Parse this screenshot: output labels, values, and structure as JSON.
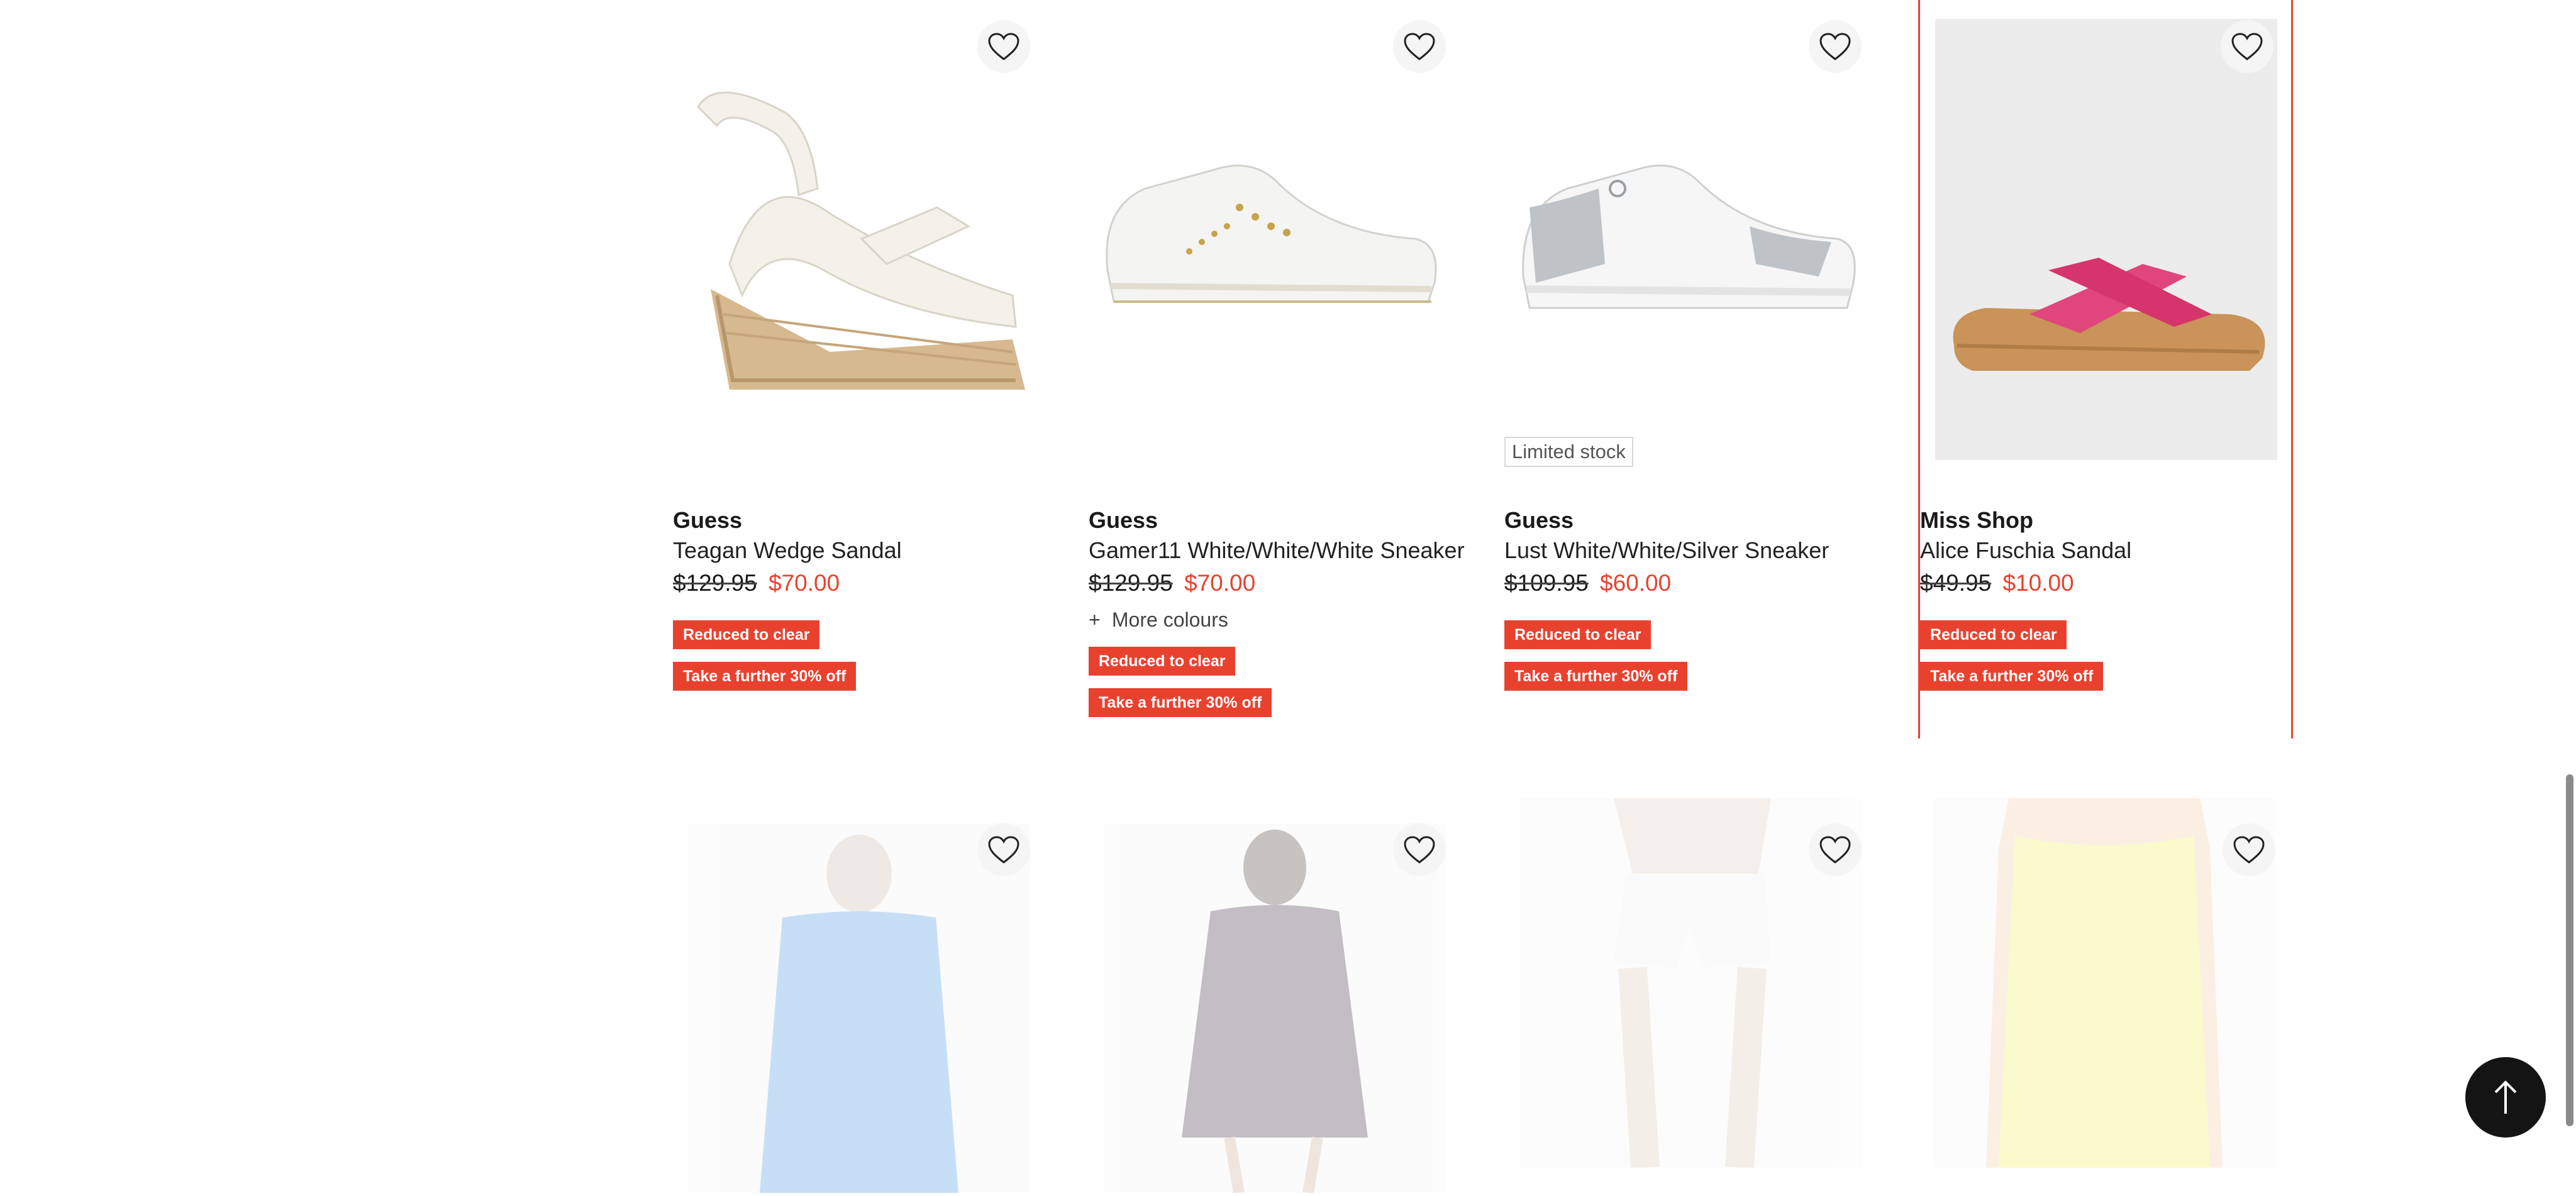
{
  "products": [
    {
      "brand": "Guess",
      "name": "Teagan Wedge Sandal",
      "was_price": "$129.95",
      "now_price": "$70.00",
      "tags": [
        "Reduced to clear",
        "Take a further 30% off"
      ],
      "more_colours": null,
      "limited": null,
      "image_icon": "wedge-sandal-image"
    },
    {
      "brand": "Guess",
      "name": "Gamer11 White/White/White Sneaker",
      "was_price": "$129.95",
      "now_price": "$70.00",
      "tags": [
        "Reduced to clear",
        "Take a further 30% off"
      ],
      "more_colours": "More colours",
      "limited": null,
      "image_icon": "sneaker-image"
    },
    {
      "brand": "Guess",
      "name": "Lust White/White/Silver Sneaker",
      "was_price": "$109.95",
      "now_price": "$60.00",
      "tags": [
        "Reduced to clear",
        "Take a further 30% off"
      ],
      "more_colours": null,
      "limited": "Limited stock",
      "image_icon": "silver-sneaker-image"
    },
    {
      "brand": "Miss Shop",
      "name": "Alice Fuschia Sandal",
      "was_price": "$49.95",
      "now_price": "$10.00",
      "tags": [
        "Reduced to clear",
        "Take a further 30% off"
      ],
      "more_colours": null,
      "limited": null,
      "image_icon": "fuschia-slide-sandal-image"
    }
  ],
  "next_row": [
    {
      "image_icon": "blue-tank-top-image"
    },
    {
      "image_icon": "floral-dress-image"
    },
    {
      "image_icon": "white-shorts-image"
    },
    {
      "image_icon": "yellow-top-image"
    }
  ],
  "colors": {
    "accent": "#e8422f",
    "text": "#1a1a1a",
    "backtop": "#141414"
  }
}
